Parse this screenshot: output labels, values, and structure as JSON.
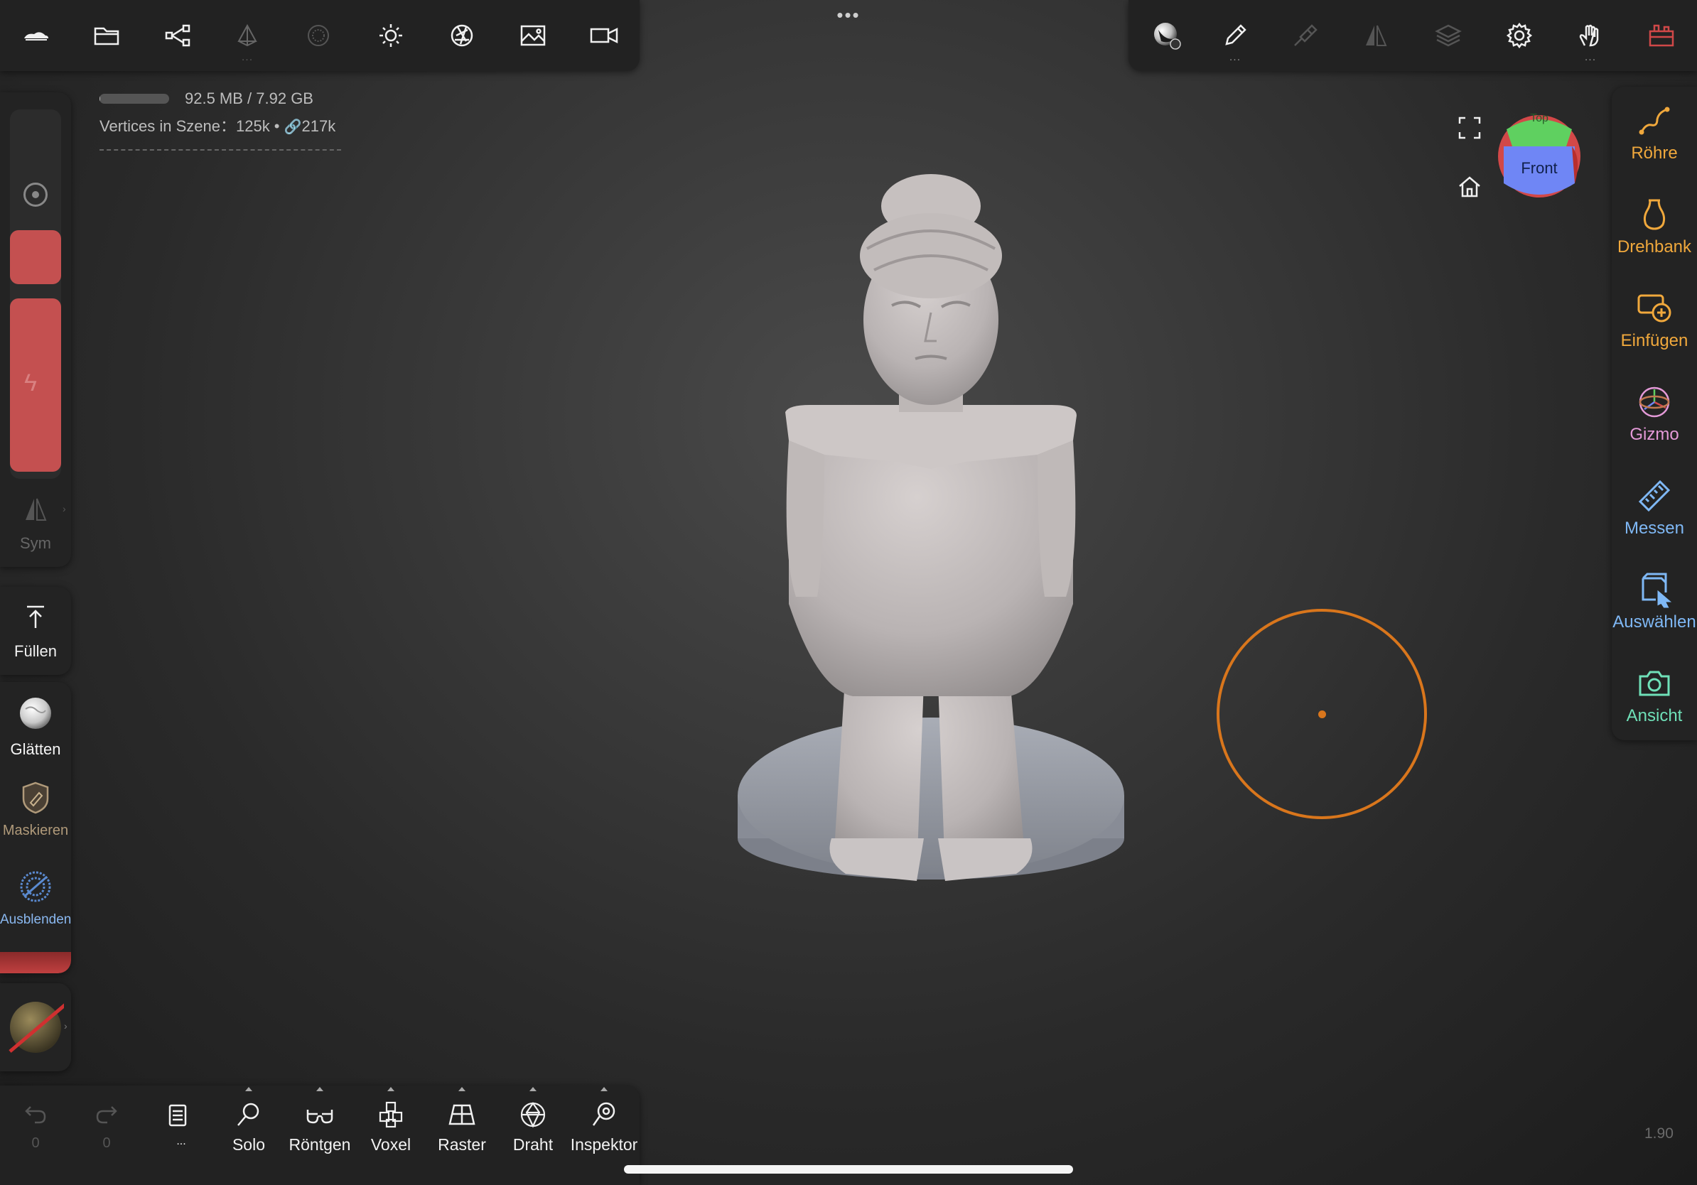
{
  "top_toolbar_left": {
    "icons": [
      "cloud-logo-icon",
      "folder-icon",
      "scene-graph-icon",
      "material-gem-icon",
      "matcap-sphere-icon",
      "sun-icon",
      "aperture-icon",
      "image-icon",
      "video-camera-icon"
    ]
  },
  "center_menu": {
    "label": "•••"
  },
  "top_toolbar_right": {
    "icons": [
      "shading-sphere-icon",
      "brush-pen-icon",
      "paint-tool-icon",
      "symmetry-icon",
      "layers-icon",
      "settings-gear-icon",
      "gesture-hand-icon",
      "toolbox-icon"
    ],
    "brush_dots": "...",
    "hand_dots": "..."
  },
  "stats": {
    "memory": "92.5 MB / 7.92 GB",
    "memory_fraction": 0.012,
    "vertices_label": "Vertices in Szene：125k • ",
    "vertices_linked": "217k"
  },
  "left_sidebar": {
    "sym_label": "Sym",
    "fill_label": "Füllen",
    "smooth_label": "Glätten",
    "mask_label": "Maskieren",
    "hide_label": "Ausblenden"
  },
  "right_sidebar": {
    "items": [
      {
        "label": "Röhre",
        "color": "#f0a83c"
      },
      {
        "label": "Drehbank",
        "color": "#f0a83c"
      },
      {
        "label": "Einfügen",
        "color": "#f0a83c"
      },
      {
        "label": "Gizmo",
        "color": "#e49ad8"
      },
      {
        "label": "Messen",
        "color": "#7fb8f5"
      },
      {
        "label": "Auswählen",
        "color": "#7fb8f5"
      },
      {
        "label": "Ansicht",
        "color": "#6fe0b8"
      }
    ]
  },
  "view_cube": {
    "front_label": "Front",
    "top_label": "Top"
  },
  "bottom_toolbar": {
    "undo_count": "0",
    "redo_count": "0",
    "history_dots": "...",
    "items": [
      "Solo",
      "Röntgen",
      "Voxel",
      "Raster",
      "Draht",
      "Inspektor"
    ]
  },
  "version": "1.90",
  "colors": {
    "accent_orange": "#d9761c",
    "panel_bg": "#232323",
    "red_slider": "#c45050"
  }
}
